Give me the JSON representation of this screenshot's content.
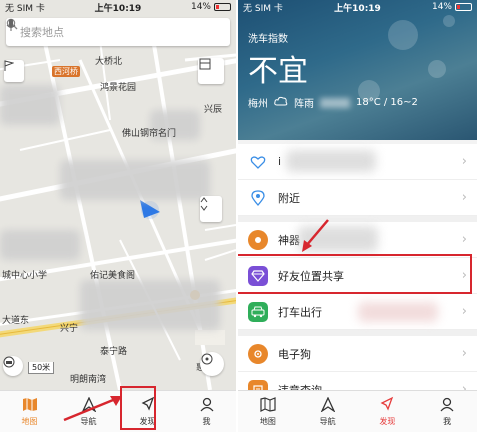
{
  "status_left": {
    "carrier": "无 SIM 卡",
    "time": "上午10:19",
    "battery": "14%"
  },
  "status_right": {
    "carrier": "无 SIM 卡",
    "time": "上午10:19",
    "battery": "14%"
  },
  "map": {
    "search_placeholder": "搜索地点",
    "labels": {
      "xihemiao": "西河桥",
      "dabei": "大桥北",
      "huajing": "鸿景花园",
      "foshan_gate": "佛山钢帘名门",
      "xingyuan": "兴辰",
      "cheng_school": "城中心小学",
      "youji": "佑记美食阁",
      "dayong": "大道东",
      "xingning": "兴宁",
      "taining": "泰宁路",
      "hui": "惠",
      "mingwan": "明朗南湾"
    },
    "scale": "50米",
    "highlight_color": "#d7262e"
  },
  "left_tabs": [
    {
      "label": "地图",
      "icon": "map-icon"
    },
    {
      "label": "导航",
      "icon": "navigation-icon"
    },
    {
      "label": "发现",
      "icon": "compass-icon"
    },
    {
      "label": "我",
      "icon": "person-icon"
    }
  ],
  "hero": {
    "subtitle": "洗车指数",
    "title": "不宜",
    "city": "梅州",
    "weather": "阵雨",
    "temp": "18°C / 16~2"
  },
  "list": [
    {
      "label": "i",
      "icon": "heart-shield-icon",
      "color": "#3a8ee6"
    },
    {
      "label": "附近",
      "icon": "location-pin-icon",
      "color": "#3a8ee6"
    },
    {
      "label": "神器",
      "icon": "orange-app-icon",
      "color": "#e8872b"
    },
    {
      "label": "好友位置共享",
      "icon": "diamond-icon",
      "color": "#7a4fd6"
    },
    {
      "label": "打车出行",
      "icon": "car-icon",
      "color": "#2fae5a"
    },
    {
      "label": "电子狗",
      "icon": "camera-icon",
      "color": "#e8872b"
    },
    {
      "label": "违章查询",
      "icon": "ticket-icon",
      "color": "#e8872b"
    }
  ],
  "right_tabs": [
    {
      "label": "地图",
      "icon": "map-icon"
    },
    {
      "label": "导航",
      "icon": "navigation-icon"
    },
    {
      "label": "发现",
      "icon": "compass-icon"
    },
    {
      "label": "我",
      "icon": "person-icon"
    }
  ],
  "colors": {
    "accent_orange": "#e8872b",
    "accent_red": "#e63c3c",
    "highlight_box": "#d7262e"
  }
}
